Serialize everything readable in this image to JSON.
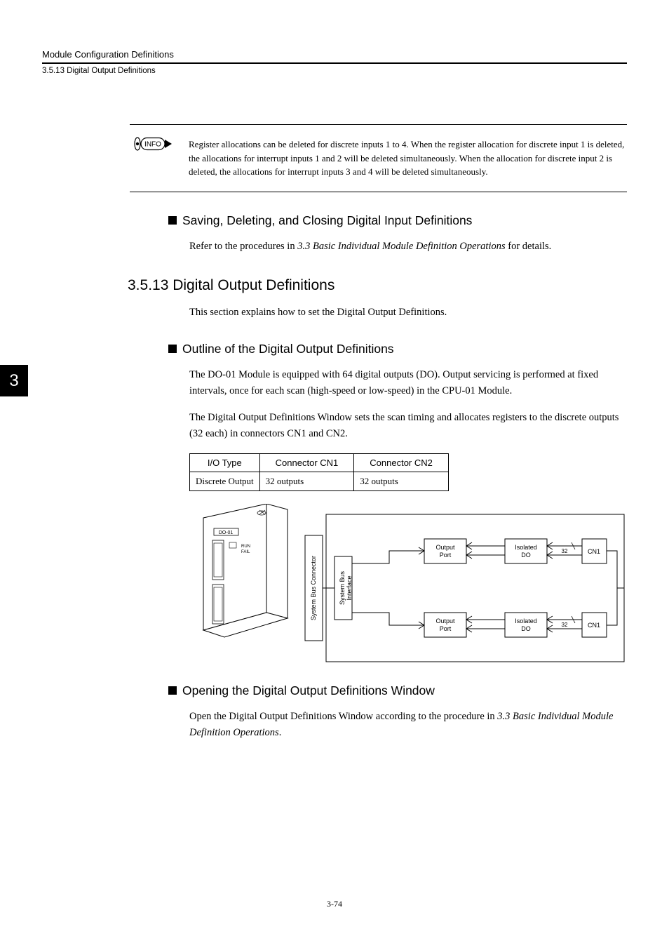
{
  "header": {
    "title": "Module Configuration Definitions",
    "subtitle": "3.5.13  Digital Output Definitions"
  },
  "chapter_tab": "3",
  "info": {
    "label": "INFO",
    "text": "Register allocations can be deleted for discrete inputs 1 to 4. When the register allocation for discrete input 1 is deleted, the allocations for interrupt inputs 1 and 2 will be deleted simultaneously. When the allocation for discrete input 2 is deleted, the allocations for interrupt inputs 3 and 4 will be deleted simultaneously."
  },
  "sec1": {
    "title": "Saving, Deleting, and Closing Digital Input Definitions",
    "p_pre": "Refer to the procedures in ",
    "p_ital": "3.3 Basic Individual Module Definition Operations",
    "p_post": " for details."
  },
  "h2": "3.5.13  Digital Output Definitions",
  "intro": "This section explains how to set the Digital Output Definitions.",
  "sec2": {
    "title": "Outline of the Digital Output Definitions",
    "p1": "The DO-01 Module is equipped with 64 digital outputs (DO). Output servicing is performed at fixed intervals, once for each scan (high-speed or low-speed) in the CPU-01 Module.",
    "p2": "The Digital Output Definitions Window sets the scan timing and allocates registers to the discrete outputs (32 each) in connectors CN1 and CN2."
  },
  "table": {
    "h1": "I/O Type",
    "h2": "Connector CN1",
    "h3": "Connector CN2",
    "r1c1": "Discrete Output",
    "r1c2": "32 outputs",
    "r1c3": "32 outputs"
  },
  "diagram": {
    "module_label": "DO-01",
    "sys_bus_conn": "System Bus Connector",
    "sys_bus_if": "System Bus Interface",
    "out_port": "Output Port",
    "iso_do": "Isolated DO",
    "count": "32",
    "cn1": "CN1"
  },
  "sec3": {
    "title": "Opening the Digital Output Definitions Window",
    "p_pre": "Open the Digital Output Definitions Window according to the procedure in ",
    "p_ital": "3.3 Basic Individual Module Definition Operations",
    "p_post": "."
  },
  "page_num": "3-74"
}
